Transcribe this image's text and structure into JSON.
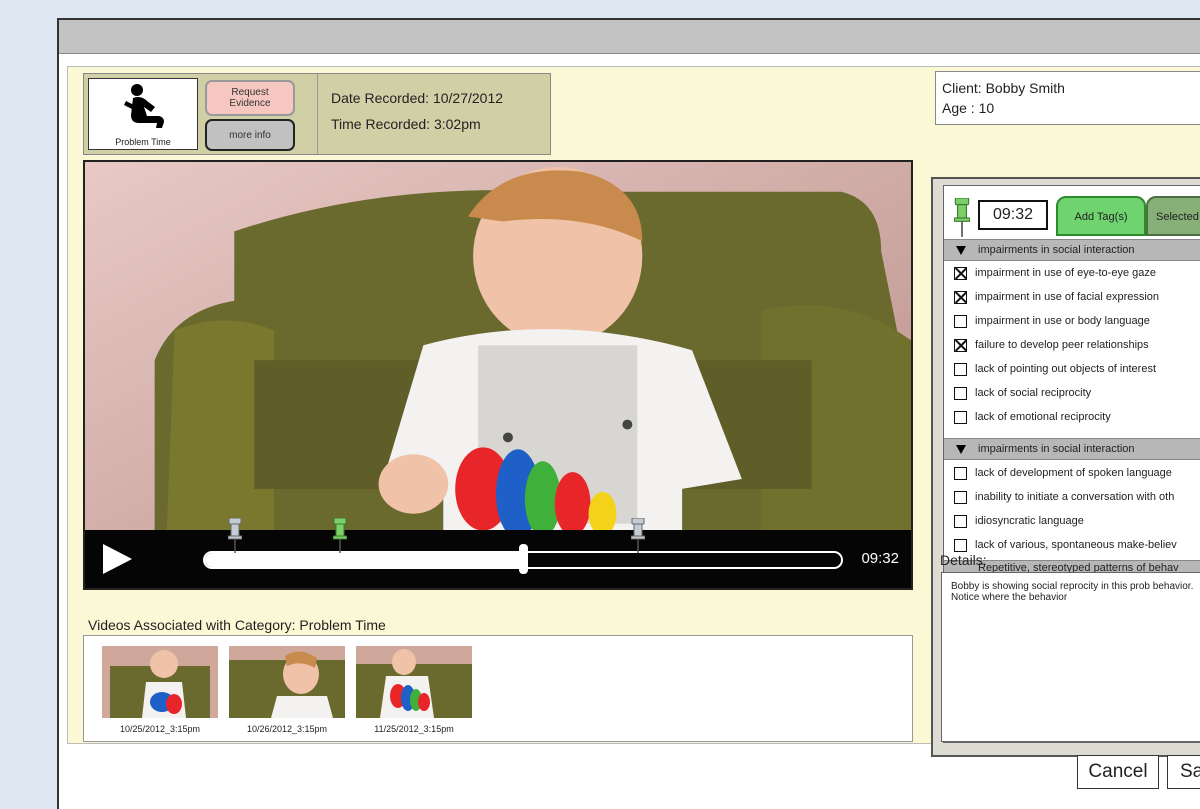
{
  "header": {
    "category_label": "Problem Time",
    "request_button": "Request Evidence",
    "more_info_button": "more info",
    "date_recorded": "Date Recorded: 10/27/2012",
    "time_recorded": "Time Recorded: 3:02pm"
  },
  "client": {
    "name_line": "Client: Bobby Smith",
    "age_line": "Age : 10"
  },
  "player": {
    "duration_display": "09:32",
    "progress_fraction": 0.5
  },
  "associated": {
    "title": "Videos Associated with Category: Problem Time",
    "videos": [
      {
        "label": "10/25/2012_3:15pm"
      },
      {
        "label": "10/26/2012_3:15pm"
      },
      {
        "label": "11/25/2012_3:15pm"
      }
    ]
  },
  "tags": {
    "current_time": "09:32",
    "add_tab": "Add Tag(s)",
    "selected_tab": "Selected T",
    "sections": [
      {
        "title": "impairments in social interaction",
        "expanded": true,
        "items": [
          {
            "label": "impairment in use of eye-to-eye gaze",
            "checked": true
          },
          {
            "label": "impairment in use of facial expression",
            "checked": true
          },
          {
            "label": "impairment in use or body language",
            "checked": false
          },
          {
            "label": "failure to develop peer relationships",
            "checked": true
          },
          {
            "label": "lack of pointing out objects of interest",
            "checked": false
          },
          {
            "label": "lack of social reciprocity",
            "checked": false
          },
          {
            "label": "lack of emotional reciprocity",
            "checked": false
          }
        ]
      },
      {
        "title": "impairments in social interaction",
        "expanded": true,
        "items": [
          {
            "label": "lack of development of spoken language",
            "checked": false
          },
          {
            "label": "inability to initiate a conversation with oth",
            "checked": false
          },
          {
            "label": "idiosyncratic language",
            "checked": false
          },
          {
            "label": "lack of various, spontaneous make-believ",
            "checked": false
          }
        ]
      },
      {
        "title": "Repetitive, stereotyped patterns of behav",
        "expanded": false,
        "items": []
      }
    ]
  },
  "details": {
    "label": "Details:",
    "text": "Bobby is showing social reprocity in this prob behavior. Notice where the behavior"
  },
  "buttons": {
    "cancel": "Cancel",
    "save": "Sa"
  },
  "colors": {
    "panel_bg": "#fbf8d6",
    "header_strip": "#d1cfa6",
    "request_button": "#f6c7c0",
    "add_tag_tab": "#6fd46f",
    "selected_tab": "#87b078",
    "page_bg": "#dde8f3"
  }
}
